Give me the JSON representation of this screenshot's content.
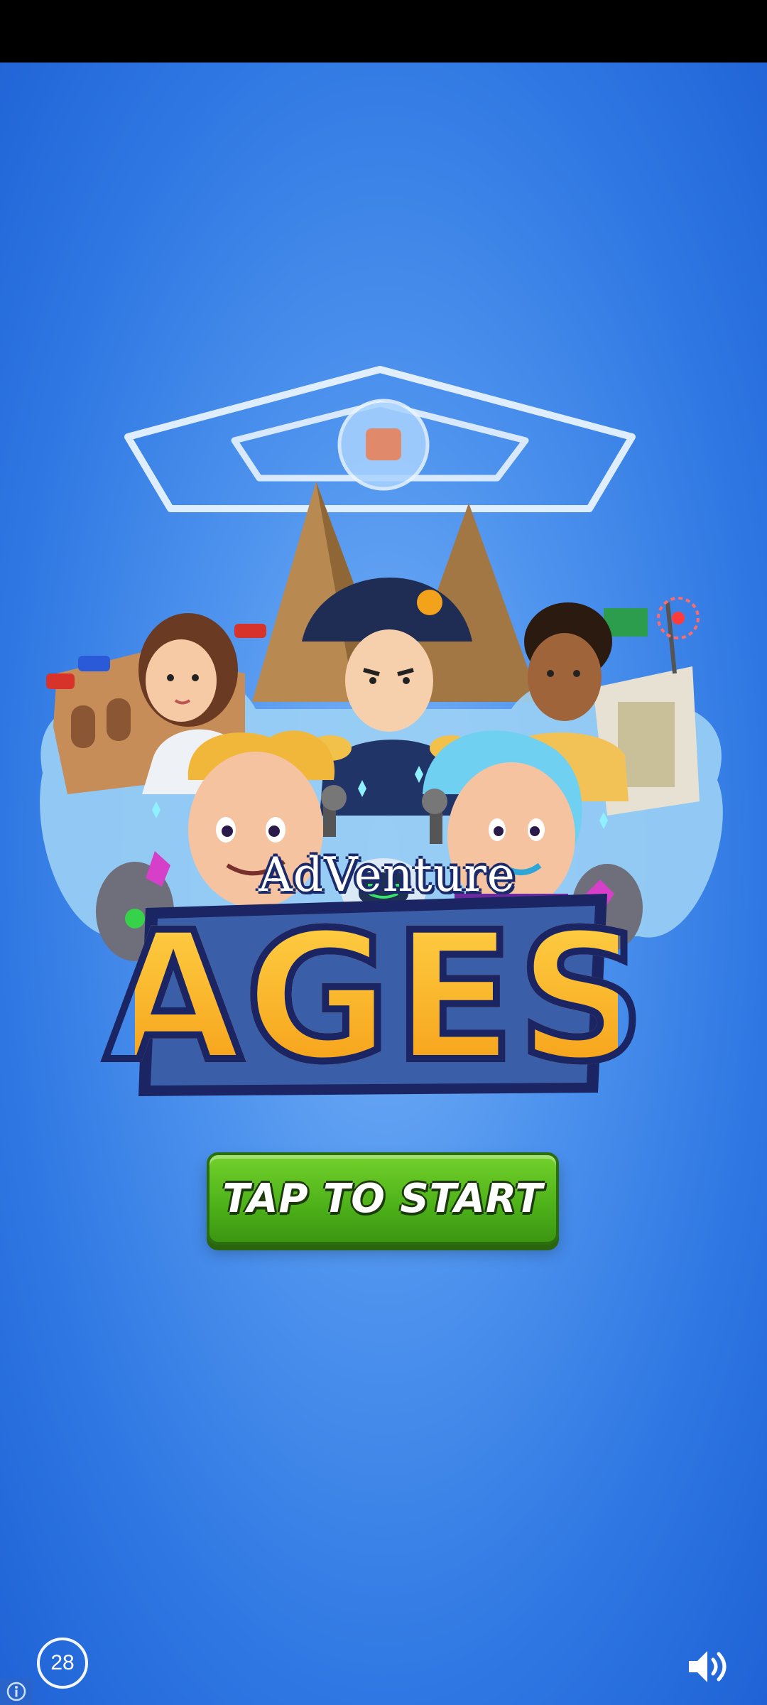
{
  "game": {
    "logo_top": "AdVenture",
    "logo_title": "AGES",
    "start_button_label": "TAP TO START",
    "countdown_value": "28",
    "colors": {
      "background_top": "#1f62d6",
      "background_center": "#7ab4f7",
      "button_green": "#4fb31a",
      "title_orange": "#f59a12",
      "outline_navy": "#1c2563"
    },
    "icons": {
      "sound": "speaker-volume-icon",
      "info": "info-icon",
      "timer": "countdown-ring-icon"
    }
  }
}
